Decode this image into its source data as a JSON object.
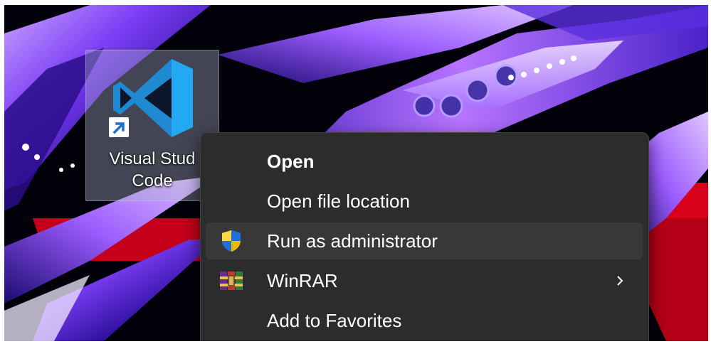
{
  "desktop": {
    "icon": {
      "name_line1": "Visual Stud",
      "name_line2": "Code",
      "app_icon": "vscode-icon",
      "overlay_icon": "shortcut-arrow-icon"
    }
  },
  "context_menu": {
    "items": [
      {
        "label": "Open",
        "bold": true,
        "icon": null
      },
      {
        "label": "Open file location",
        "bold": false,
        "icon": null
      },
      {
        "label": "Run as administrator",
        "bold": false,
        "icon": "uac-shield-icon",
        "highlighted": true
      },
      {
        "label": "WinRAR",
        "bold": false,
        "icon": "winrar-icon",
        "submenu": true,
        "submenu_icon": "chevron-right-icon"
      },
      {
        "label": "Add to Favorites",
        "bold": false,
        "icon": null
      }
    ]
  },
  "colors": {
    "menu_background": "#2c2c2c",
    "menu_hover": "#383838",
    "menu_text": "#ffffff",
    "vscode_blue": "#23a9f2",
    "wallpaper_red": "#d8001b",
    "wallpaper_purple": "#8a3cff"
  }
}
